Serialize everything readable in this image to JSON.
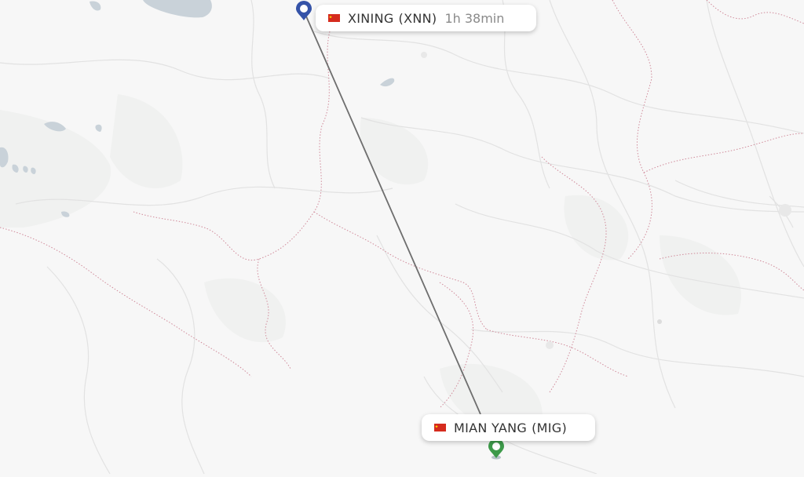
{
  "origin": {
    "city": "XINING",
    "code": "(XNN)",
    "flag_icon": "china-flag-icon",
    "pin_color": "#3553a8"
  },
  "destination": {
    "city": "MIAN YANG",
    "code": "(MIG)",
    "flag_icon": "china-flag-icon",
    "pin_color": "#3d9a4a"
  },
  "flight": {
    "duration": "1h 38min",
    "route_color": "#6e6e6e"
  },
  "map": {
    "background_color": "#f7f7f7",
    "water_color": "#c9d2d9",
    "border_color": "#d08a9a",
    "road_color": "#e2e2e2"
  }
}
